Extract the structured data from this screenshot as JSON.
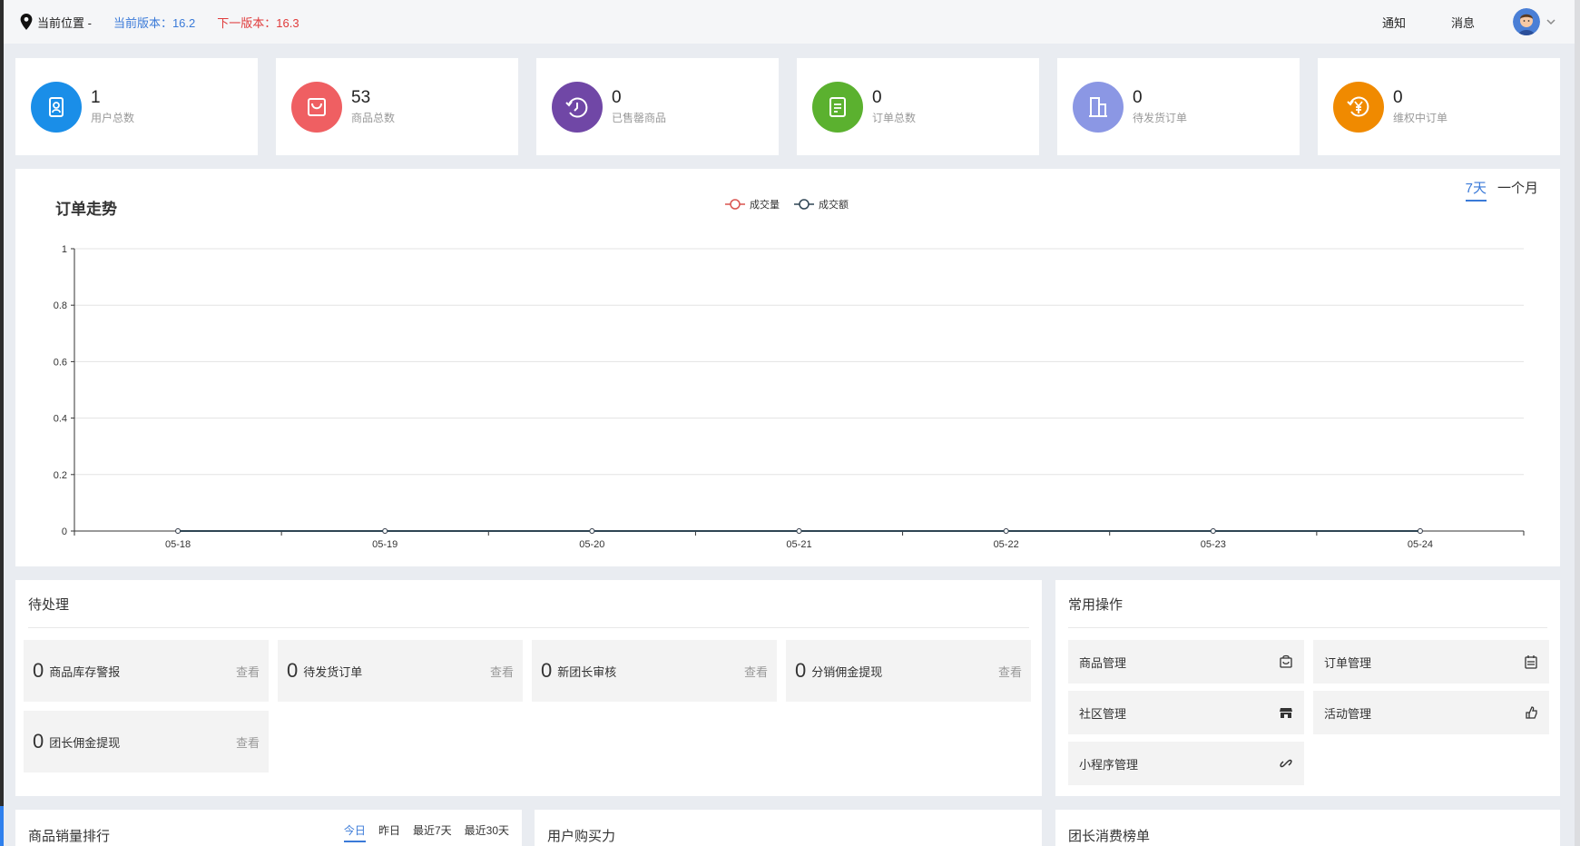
{
  "header": {
    "location_label": "当前位置 -",
    "current_version": "当前版本：16.2",
    "next_version": "下一版本：16.3",
    "notify": "通知",
    "message": "消息"
  },
  "stats": [
    {
      "value": "1",
      "label": "用户总数",
      "color": "#1a8ee8",
      "icon": "user-card-icon"
    },
    {
      "value": "53",
      "label": "商品总数",
      "color": "#ef5f62",
      "icon": "shopping-bag-icon"
    },
    {
      "value": "0",
      "label": "已售罄商品",
      "color": "#7047a6",
      "icon": "clock-icon"
    },
    {
      "value": "0",
      "label": "订单总数",
      "color": "#5bb12f",
      "icon": "document-icon"
    },
    {
      "value": "0",
      "label": "待发货订单",
      "color": "#8b97e4",
      "icon": "building-icon"
    },
    {
      "value": "0",
      "label": "维权中订单",
      "color": "#f08a00",
      "icon": "yuan-icon"
    }
  ],
  "chart": {
    "title": "订单走势",
    "range_tabs": [
      "7天",
      "一个月"
    ],
    "active_range": "7天"
  },
  "chart_data": {
    "type": "line",
    "x": [
      "05-18",
      "05-19",
      "05-20",
      "05-21",
      "05-22",
      "05-23",
      "05-24"
    ],
    "series": [
      {
        "name": "成交量",
        "values": [
          0,
          0,
          0,
          0,
          0,
          0,
          0
        ],
        "color": "#d9534f"
      },
      {
        "name": "成交额",
        "values": [
          0,
          0,
          0,
          0,
          0,
          0,
          0
        ],
        "color": "#2f4554"
      }
    ],
    "yticks": [
      "0",
      "0.2",
      "0.4",
      "0.6",
      "0.8",
      "1"
    ],
    "ylim": [
      0,
      1
    ],
    "grid": true,
    "legend": "top-center"
  },
  "pending": {
    "title": "待处理",
    "view_label": "查看",
    "items": [
      {
        "count": "0",
        "label": "商品库存警报"
      },
      {
        "count": "0",
        "label": "待发货订单"
      },
      {
        "count": "0",
        "label": "新团长审核"
      },
      {
        "count": "0",
        "label": "分销佣金提现"
      },
      {
        "count": "0",
        "label": "团长佣金提现"
      }
    ]
  },
  "ops": {
    "title": "常用操作",
    "items": [
      {
        "label": "商品管理",
        "icon": "bag-icon"
      },
      {
        "label": "订单管理",
        "icon": "calendar-icon"
      },
      {
        "label": "社区管理",
        "icon": "store-icon"
      },
      {
        "label": "活动管理",
        "icon": "hand-icon"
      },
      {
        "label": "小程序管理",
        "icon": "link-icon"
      }
    ]
  },
  "bottom": {
    "rank_title": "商品销量排行",
    "rank_tabs": [
      "今日",
      "昨日",
      "最近7天",
      "最近30天"
    ],
    "active_rank_tab": "今日",
    "purchase_title": "用户购买力",
    "leader_title": "团长消费榜单"
  }
}
